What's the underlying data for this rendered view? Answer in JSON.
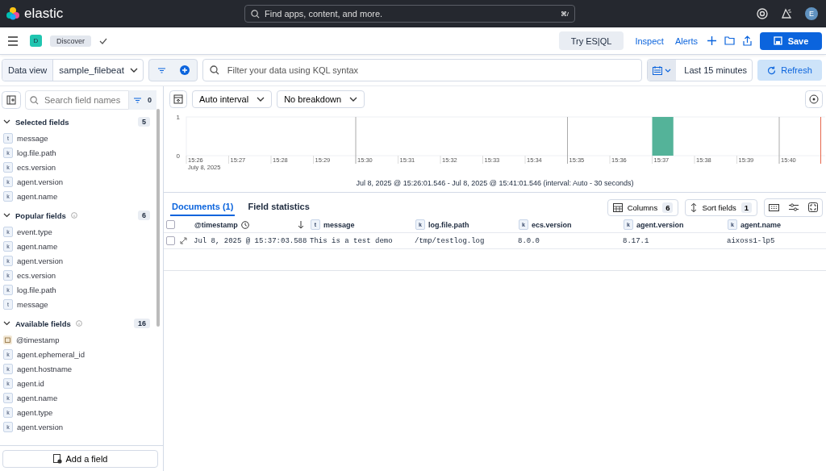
{
  "header": {
    "brand": "elastic",
    "search": {
      "placeholder": "Find apps, content, and more.",
      "shortcut": "⌘/"
    },
    "avatar": "E"
  },
  "app_bar": {
    "space": "D",
    "breadcrumb": "Discover",
    "actions": [
      "Try ES|QL",
      "Inspect",
      "Alerts"
    ],
    "save": "Save"
  },
  "query_bar": {
    "data_view_label": "Data view",
    "data_view": "sample_filebeat",
    "query": {
      "placeholder": "Filter your data using KQL syntax"
    },
    "time_range": "Last 15 minutes",
    "refresh": "Refresh"
  },
  "sidebar": {
    "search": {
      "placeholder": "Search field names"
    },
    "filter_count": "0",
    "sections": [
      {
        "title": "Selected fields",
        "count": "5",
        "info": false,
        "fields": [
          {
            "kind": "badge",
            "badge": "t",
            "name": "message"
          },
          {
            "kind": "badge",
            "badge": "k",
            "name": "log.file.path"
          },
          {
            "kind": "badge",
            "badge": "k",
            "name": "ecs.version"
          },
          {
            "kind": "badge",
            "badge": "k",
            "name": "agent.version"
          },
          {
            "kind": "badge",
            "badge": "k",
            "name": "agent.name"
          }
        ]
      },
      {
        "title": "Popular fields",
        "count": "6",
        "info": true,
        "fields": [
          {
            "kind": "badge",
            "badge": "k",
            "name": "event.type"
          },
          {
            "kind": "badge",
            "badge": "k",
            "name": "agent.name"
          },
          {
            "kind": "badge",
            "badge": "k",
            "name": "agent.version"
          },
          {
            "kind": "badge",
            "badge": "k",
            "name": "ecs.version"
          },
          {
            "kind": "badge",
            "badge": "k",
            "name": "log.file.path"
          },
          {
            "kind": "badge",
            "badge": "t",
            "name": "message"
          }
        ]
      },
      {
        "title": "Available fields",
        "count": "16",
        "info": true,
        "fields": [
          {
            "kind": "date",
            "name": "@timestamp"
          },
          {
            "kind": "badge",
            "badge": "k",
            "name": "agent.ephemeral_id"
          },
          {
            "kind": "badge",
            "badge": "k",
            "name": "agent.hostname"
          },
          {
            "kind": "badge",
            "badge": "k",
            "name": "agent.id"
          },
          {
            "kind": "badge",
            "badge": "k",
            "name": "agent.name"
          },
          {
            "kind": "badge",
            "badge": "k",
            "name": "agent.type"
          },
          {
            "kind": "badge",
            "badge": "k",
            "name": "agent.version"
          }
        ]
      }
    ],
    "add_field": "Add a field"
  },
  "histogram": {
    "interval": "Auto interval",
    "breakdown": "No breakdown",
    "chart_data": {
      "type": "bar",
      "categories": [
        "15:26",
        "15:27",
        "15:28",
        "15:29",
        "15:30",
        "15:31",
        "15:32",
        "15:33",
        "15:34",
        "15:35",
        "15:36",
        "15:37",
        "15:38",
        "15:39",
        "15:40"
      ],
      "values": [
        0,
        0,
        0,
        0,
        0,
        0,
        0,
        0,
        0,
        0,
        0,
        1,
        0,
        0,
        0
      ],
      "yticks": [
        0,
        1
      ],
      "ylim": [
        0,
        1
      ],
      "xlabel": "July 8, 2025"
    },
    "caption": "Jul 8, 2025 @ 15:26:01.546 - Jul 8, 2025 @ 15:41:01.546 (interval: Auto - 30 seconds)"
  },
  "tabs": [
    {
      "label": "Documents (1)",
      "selected": true
    },
    {
      "label": "Field statistics",
      "selected": false
    }
  ],
  "toolbar": {
    "columns": "Columns",
    "columns_count": "6",
    "sort": "Sort fields",
    "sort_count": "1"
  },
  "table": {
    "select_all": false,
    "columns": [
      {
        "kind": "date",
        "name": "@timestamp"
      },
      {
        "kind": "badge",
        "badge": "t",
        "name": "message"
      },
      {
        "kind": "badge",
        "badge": "k",
        "name": "log.file.path"
      },
      {
        "kind": "badge",
        "badge": "k",
        "name": "ecs.version"
      },
      {
        "kind": "badge",
        "badge": "k",
        "name": "agent.version"
      },
      {
        "kind": "badge",
        "badge": "k",
        "name": "agent.name"
      }
    ],
    "rows": [
      {
        "selected": false,
        "cells": [
          "Jul 8, 2025 @ 15:37:03.588",
          "This is a test demo",
          "/tmp/testlog.log",
          "8.0.0",
          "8.17.1",
          "aixoss1-lp5"
        ]
      }
    ]
  }
}
